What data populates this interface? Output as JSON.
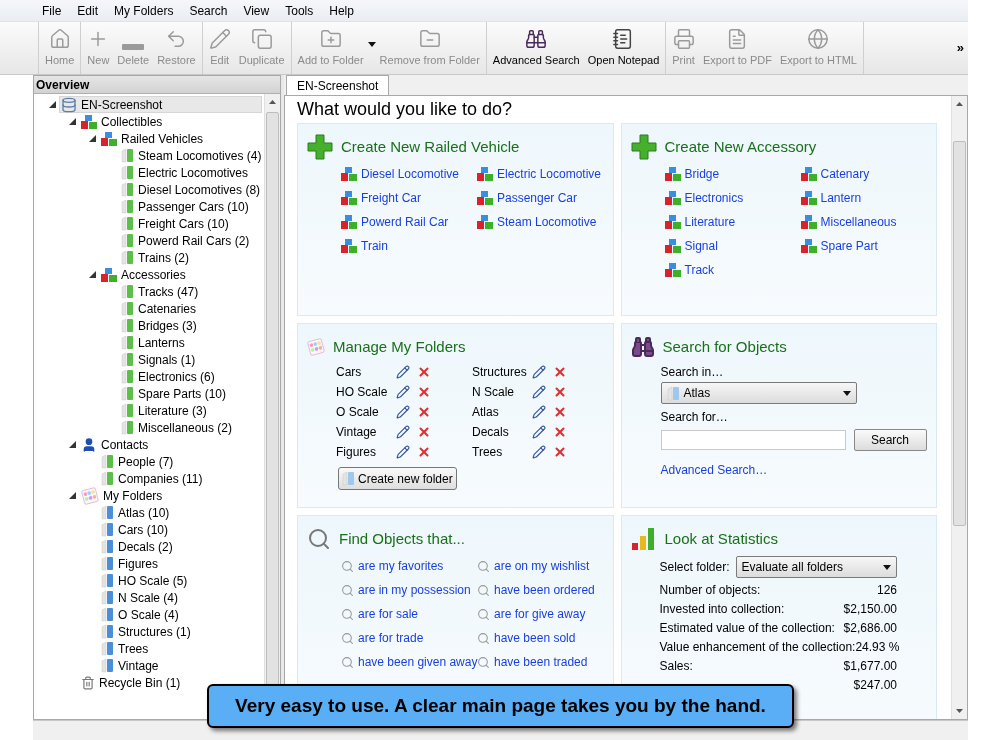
{
  "menu": [
    "File",
    "Edit",
    "My Folders",
    "Search",
    "View",
    "Tools",
    "Help"
  ],
  "toolbar": {
    "groups": [
      [
        {
          "label": "Home",
          "kind": "home",
          "disabled": true
        }
      ],
      [
        {
          "label": "New",
          "kind": "new",
          "disabled": true
        },
        {
          "label": "Delete",
          "kind": "delete",
          "disabled": true
        },
        {
          "label": "Restore",
          "kind": "restore",
          "disabled": true
        }
      ],
      [
        {
          "label": "Edit",
          "kind": "edit",
          "disabled": true
        },
        {
          "label": "Duplicate",
          "kind": "duplicate",
          "disabled": true
        }
      ],
      [
        {
          "label": "Add to Folder",
          "kind": "add-folder",
          "disabled": true,
          "menu": true
        },
        {
          "label": "Remove from Folder",
          "kind": "remove-folder",
          "disabled": true
        }
      ],
      [
        {
          "label": "Advanced Search",
          "kind": "search",
          "disabled": false
        },
        {
          "label": "Open Notepad",
          "kind": "notepad",
          "disabled": false
        }
      ],
      [
        {
          "label": "Print",
          "kind": "print",
          "disabled": true
        },
        {
          "label": "Export to PDF",
          "kind": "pdf",
          "disabled": true
        },
        {
          "label": "Export to HTML",
          "kind": "html",
          "disabled": true
        }
      ]
    ],
    "overflow": "»"
  },
  "sidebar": {
    "title": "Overview",
    "tree": [
      {
        "label": "EN-Screenshot",
        "kind": "database",
        "selected": true,
        "expanded": true,
        "children": [
          {
            "label": "Collectibles",
            "kind": "collection",
            "selected": false,
            "expanded": true,
            "children": [
              {
                "label": "Railed Vehicles",
                "kind": "collection",
                "selected": false,
                "expanded": true,
                "children": [
                  {
                    "label": "Steam Locomotives (4)",
                    "kind": "category",
                    "selected": false
                  },
                  {
                    "label": "Electric Locomotives",
                    "kind": "category",
                    "selected": false
                  },
                  {
                    "label": "Diesel Locomotives (8)",
                    "kind": "category",
                    "selected": false
                  },
                  {
                    "label": "Passenger Cars (10)",
                    "kind": "category",
                    "selected": false
                  },
                  {
                    "label": "Freight Cars (10)",
                    "kind": "category",
                    "selected": false
                  },
                  {
                    "label": "Powerd Rail Cars (2)",
                    "kind": "category",
                    "selected": false
                  },
                  {
                    "label": "Trains (2)",
                    "kind": "category",
                    "selected": false
                  }
                ]
              },
              {
                "label": "Accessories",
                "kind": "collection",
                "selected": false,
                "expanded": true,
                "children": [
                  {
                    "label": "Tracks (47)",
                    "kind": "category",
                    "selected": false
                  },
                  {
                    "label": "Catenaries",
                    "kind": "category",
                    "selected": false
                  },
                  {
                    "label": "Bridges (3)",
                    "kind": "category",
                    "selected": false
                  },
                  {
                    "label": "Lanterns",
                    "kind": "category",
                    "selected": false
                  },
                  {
                    "label": "Signals (1)",
                    "kind": "category",
                    "selected": false
                  },
                  {
                    "label": "Electronics (6)",
                    "kind": "category",
                    "selected": false
                  },
                  {
                    "label": "Spare Parts (10)",
                    "kind": "category",
                    "selected": false
                  },
                  {
                    "label": "Literature (3)",
                    "kind": "category",
                    "selected": false
                  },
                  {
                    "label": "Miscellaneous (2)",
                    "kind": "category",
                    "selected": false
                  }
                ]
              }
            ]
          },
          {
            "label": "Contacts",
            "kind": "contacts",
            "selected": false,
            "expanded": true,
            "children": [
              {
                "label": "People (7)",
                "kind": "category",
                "selected": false
              },
              {
                "label": "Companies (11)",
                "kind": "category",
                "selected": false
              }
            ]
          },
          {
            "label": "My Folders",
            "kind": "palette",
            "selected": false,
            "expanded": true,
            "children": [
              {
                "label": "Atlas (10)",
                "kind": "folder",
                "selected": false
              },
              {
                "label": "Cars (10)",
                "kind": "folder",
                "selected": false
              },
              {
                "label": "Decals (2)",
                "kind": "folder",
                "selected": false
              },
              {
                "label": "Figures",
                "kind": "folder",
                "selected": false
              },
              {
                "label": "HO Scale (5)",
                "kind": "folder",
                "selected": false
              },
              {
                "label": "N Scale (4)",
                "kind": "folder",
                "selected": false
              },
              {
                "label": "O Scale (4)",
                "kind": "folder",
                "selected": false
              },
              {
                "label": "Structures (1)",
                "kind": "folder",
                "selected": false
              },
              {
                "label": "Trees",
                "kind": "folder",
                "selected": false
              },
              {
                "label": "Vintage",
                "kind": "folder",
                "selected": false
              }
            ]
          },
          {
            "label": "Recycle Bin (1)",
            "kind": "bin",
            "selected": false
          }
        ]
      }
    ]
  },
  "tabs": [
    {
      "label": "EN-Screenshot",
      "selected": true
    }
  ],
  "heading": "What would you like to do?",
  "vehicle_card": {
    "title": "Create New Railed Vehicle",
    "links": [
      "Diesel Locomotive",
      "Electric Locomotive",
      "Freight Car",
      "Passenger Car",
      "Powerd Rail Car",
      "Steam Locomotive",
      "Train"
    ]
  },
  "accessory_card": {
    "title": "Create New Accessory",
    "links": [
      "Bridge",
      "Catenary",
      "Electronics",
      "Lantern",
      "Literature",
      "Miscellaneous",
      "Signal",
      "Spare Part",
      "Track"
    ]
  },
  "folders_card": {
    "title": "Manage My Folders",
    "folders": [
      "Cars",
      "Structures",
      "HO Scale",
      "N Scale",
      "O Scale",
      "Atlas",
      "Vintage",
      "Decals",
      "Figures",
      "Trees"
    ],
    "button": "Create new folder"
  },
  "search_card": {
    "title": "Search for Objects",
    "search_in_label": "Search in…",
    "search_in_value": "Atlas",
    "search_for_label": "Search for…",
    "button": "Search",
    "link": "Advanced Search…"
  },
  "find_card": {
    "title": "Find Objects that...",
    "links": [
      "are my favorites",
      "are on my wishlist",
      "are in my possession",
      "have been ordered",
      "are for sale",
      "are for give away",
      "are for trade",
      "have been sold",
      "have been given away",
      "have been traded"
    ]
  },
  "stats_card": {
    "title": "Look at Statistics",
    "select_label": "Select folder:",
    "select_value": "Evaluate all folders",
    "rows": [
      {
        "label": "Number of objects:",
        "value": "126"
      },
      {
        "label": "Invested into collection:",
        "value": "$2,150.00"
      },
      {
        "label": "Estimated value of the collection:",
        "value": "$2,686.00"
      },
      {
        "label": "Value enhancement of the collection:",
        "value": "24.93 %"
      },
      {
        "label": "Sales:",
        "value": "$1,677.00"
      },
      {
        "value": "$247.00"
      }
    ]
  },
  "callout": "Very easy to use. A clear main page takes you by the hand."
}
